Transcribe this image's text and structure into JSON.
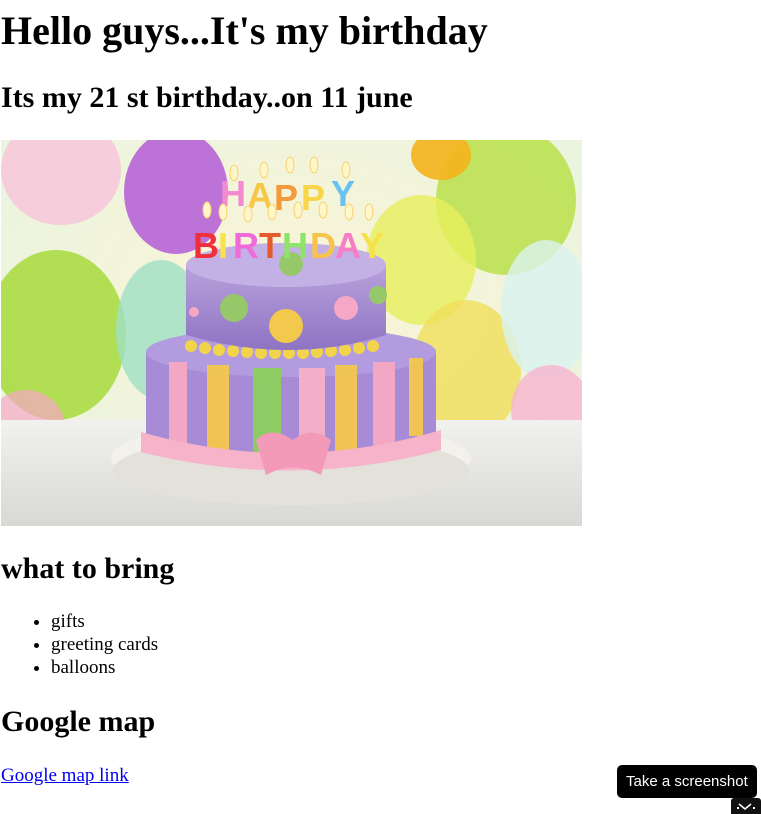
{
  "page": {
    "title": "Hello guys...It's my birthday",
    "subtitle": "Its my 21 st birthday..on 11 june"
  },
  "hero_image": {
    "description_icon": "birthday-cake-image",
    "candle_text_top": "HAPPY",
    "candle_text_bottom": "BIRTHDAY"
  },
  "bring": {
    "heading": "what to bring",
    "items": [
      "gifts",
      "greeting cards",
      "balloons"
    ]
  },
  "map": {
    "heading": "Google map",
    "link_text": "Google map link"
  },
  "overlay": {
    "tooltip_text": "Take a screenshot",
    "button_icon": "screenshot-icon"
  }
}
